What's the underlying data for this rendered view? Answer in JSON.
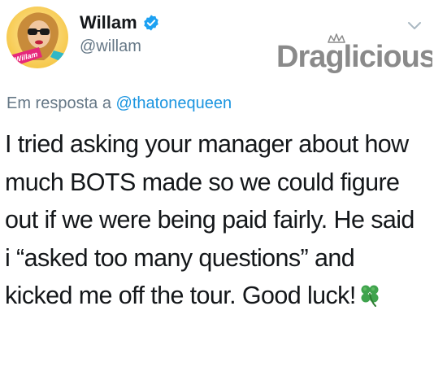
{
  "author": {
    "display_name": "Willam",
    "handle": "@willam",
    "verified": true,
    "avatar_text": "Willam"
  },
  "watermark": {
    "text": "Draglicious"
  },
  "reply": {
    "prefix": "Em resposta a",
    "mention": "@thatonequeen"
  },
  "tweet": {
    "lines": [
      "I tried asking your manager about how",
      "much BOTS made so we could figure",
      "out if we were being paid fairly. He said",
      "i “asked too many questions” and",
      "kicked me off the tour. Good luck!"
    ],
    "emoji": "four-leaf-clover"
  },
  "colors": {
    "text": "#14171a",
    "secondary": "#657786",
    "link": "#1b95e0",
    "verified": "#1da1f2",
    "clover": "#3fa34d",
    "watermark": "#8a8a8a"
  },
  "icons": {
    "verified": "verified-badge-icon",
    "menu": "chevron-down-icon"
  }
}
